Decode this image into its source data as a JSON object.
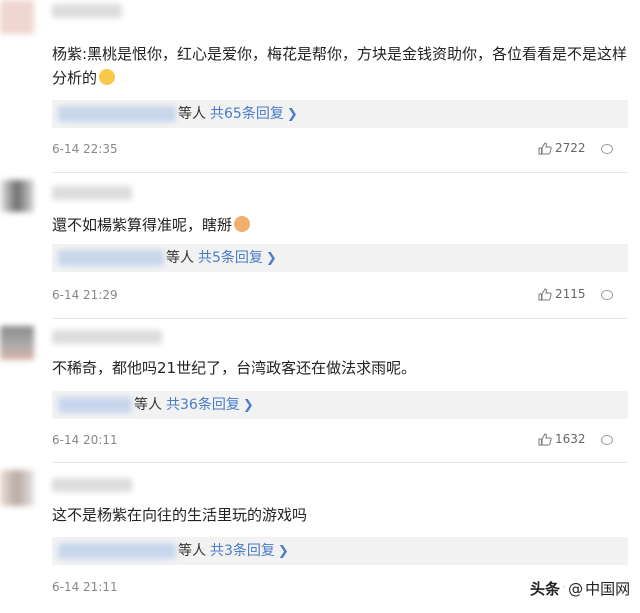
{
  "comments": [
    {
      "text": "杨紫:黑桃是恨你，红心是爱你，梅花是帮你，方块是金钱资助你，各位看看是不是这样分析的",
      "emoji": "smile-emoji",
      "reply_who": "等人",
      "reply_total": "共65条回复",
      "time": "6-14 22:35",
      "likes": "2722"
    },
    {
      "text": "還不如楊紫算得准呢，瞎掰",
      "emoji": "cat-emoji",
      "reply_who": "等人",
      "reply_total": "共5条回复",
      "time": "6-14 21:29",
      "likes": "2115"
    },
    {
      "text": "不稀奇，都他吗21世纪了，台湾政客还在做法求雨呢。",
      "emoji": "",
      "reply_who": "等人",
      "reply_total": "共36条回复",
      "time": "6-14 20:11",
      "likes": "1632"
    },
    {
      "text": "这不是杨紫在向往的生活里玩的游戏吗",
      "emoji": "",
      "reply_who": "等人",
      "reply_total": "共3条回复",
      "time": "6-14 21:11",
      "likes": ""
    }
  ],
  "watermark": {
    "brand": "头条",
    "at": "@",
    "name": "中国网"
  },
  "colors": {
    "link": "#4a7cc7",
    "reply_bg": "#f2f2f2"
  }
}
